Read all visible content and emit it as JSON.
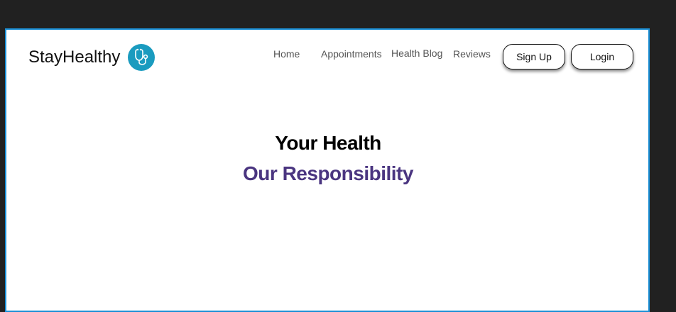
{
  "brand": {
    "name": "StayHealthy",
    "logo_icon": "stethoscope-icon",
    "logo_color": "#1a9bbf"
  },
  "nav": {
    "items": [
      {
        "label": "Home"
      },
      {
        "label": "Appointments"
      },
      {
        "label": "Health Blog"
      },
      {
        "label": "Reviews"
      }
    ]
  },
  "auth": {
    "signup_label": "Sign Up",
    "login_label": "Login"
  },
  "hero": {
    "line1": "Your Health",
    "line2": "Our Responsibility",
    "line1_color": "#000000",
    "line2_color": "#4a3580"
  },
  "colors": {
    "frame_border": "#1a8fd6",
    "background": "#212121"
  }
}
